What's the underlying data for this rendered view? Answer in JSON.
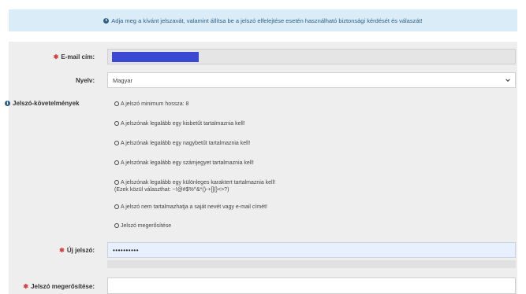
{
  "info": {
    "message": "Adja meg a kívánt jelszavát, valamint állítsa be a jelszó elfelejtése esetén használható biztonsági kérdését és válaszát!",
    "icon": "info-icon"
  },
  "form": {
    "email_label": "E-mail cím:",
    "language_label": "Nyelv:",
    "language_value": "Magyar",
    "requirements_title": "Jelszó-követelmények",
    "requirements": [
      "A jelszó minimum hossza: 8",
      "A jelszónak legalább egy kisbetűt tartalmaznia kell!",
      "A jelszónak legalább egy nagybetűt tartalmaznia kell!",
      "A jelszónak legalább egy számjegyet tartalmaznia kell!",
      "A jelszónak legalább egy különleges karaktert tartalmaznia kell!",
      "A jelszó nem tartalmazhatja a saját nevét vagy e-mail címét!",
      "Jelszó megerősítése"
    ],
    "special_chars_note": "(Ezek közül választhat: ~!@#$%^&*()-+[]{}<>?)",
    "new_password_label": "Új jelszó:",
    "new_password_value": "••••••••••",
    "confirm_password_label": "Jelszó megerősítése:",
    "required_mark": "✱"
  },
  "colors": {
    "info_bg": "#d9ecf7",
    "info_text": "#2f5f86",
    "required": "#d04040",
    "email_mask": "#3b48d1",
    "password_bg": "#e8f0fd"
  }
}
